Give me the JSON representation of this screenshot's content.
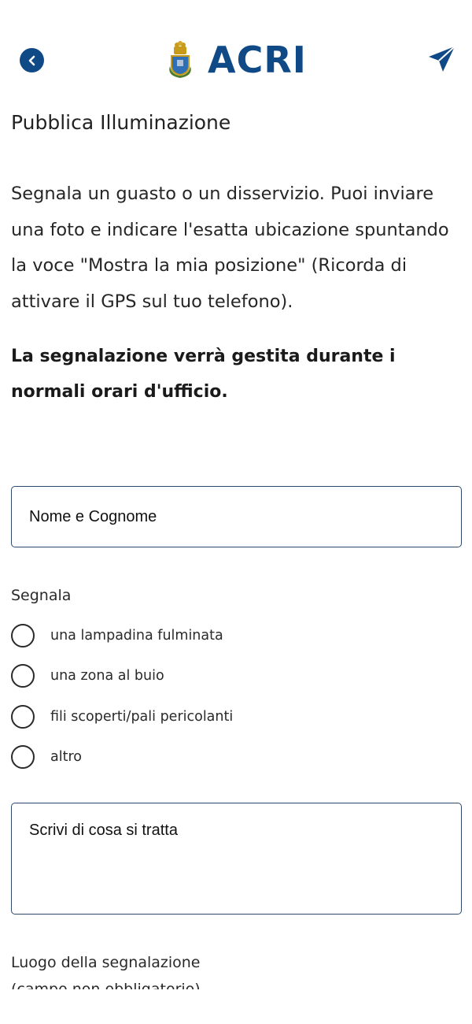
{
  "header": {
    "logo_text": "ACRI",
    "back_icon": "chevron-left-icon",
    "send_icon": "paper-plane-icon",
    "brand_color": "#0f4a86"
  },
  "page": {
    "title": "Pubblica Illuminazione",
    "intro": "Segnala un guasto o un disservizio. Puoi inviare una foto e indicare l'esatta ubicazione spuntando la voce \"Mostra la mia posizione\" (Ricorda di attivare il GPS sul tuo telefono).",
    "notice": "La segnalazione verrà gestita durante i normali orari d'ufficio."
  },
  "form": {
    "name_placeholder": "Nome e Cognome",
    "name_value": "",
    "segnala_label": "Segnala",
    "options": [
      {
        "label": "una lampadina fulminata",
        "selected": false
      },
      {
        "label": "una zona al buio",
        "selected": false
      },
      {
        "label": "fili scoperti/pali pericolanti",
        "selected": false
      },
      {
        "label": "altro",
        "selected": false
      }
    ],
    "description_placeholder": "Scrivi di cosa si tratta",
    "description_value": "",
    "location_label": "Luogo della segnalazione",
    "location_note": "(campo non obbligatorio)"
  }
}
